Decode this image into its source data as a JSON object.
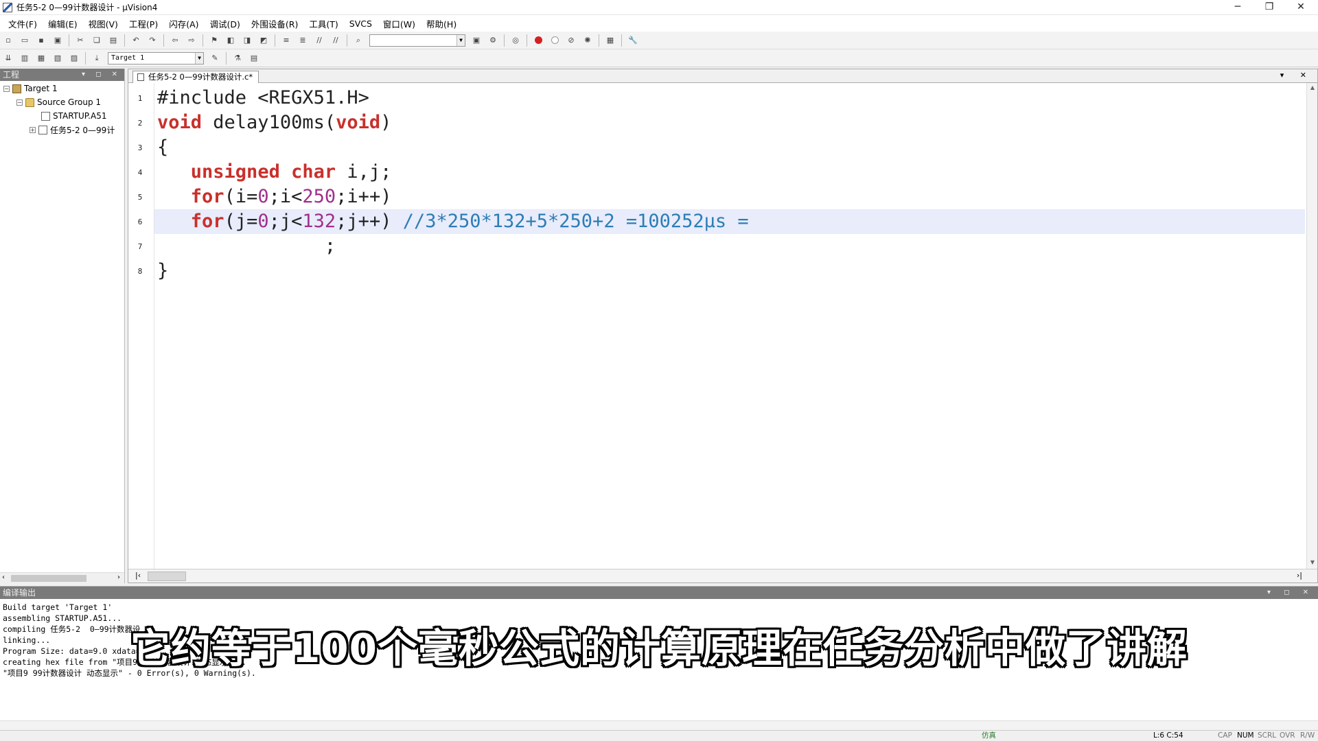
{
  "window": {
    "title": "任务5-2  0—99计数器设计 - µVision4",
    "minimize_glyph": "─",
    "restore_glyph": "❐",
    "close_glyph": "✕"
  },
  "menu": {
    "items": [
      "文件(F)",
      "编辑(E)",
      "视图(V)",
      "工程(P)",
      "闪存(A)",
      "调试(D)",
      "外围设备(R)",
      "工具(T)",
      "SVCS",
      "窗口(W)",
      "帮助(H)"
    ]
  },
  "toolbar2": {
    "target_value": "Target 1"
  },
  "project": {
    "header": "工程",
    "tree": {
      "target": "Target 1",
      "group": "Source Group 1",
      "file1": "STARTUP.A51",
      "file2": "任务5-2  0—99计"
    }
  },
  "editor": {
    "tab_label": "任务5-2  0—99计数器设计.c*",
    "line_numbers": [
      "1",
      "2",
      "3",
      "4",
      "5",
      "6",
      "7",
      "8"
    ],
    "current_line": 6,
    "code": {
      "l1": "#include <REGX51.H>",
      "l2_kw": "void",
      "l2_rest": " delay100ms(",
      "l2_kw2": "void",
      "l2_end": ")",
      "l3": "{",
      "l4_indent": "   ",
      "l4_kw1": "unsigned",
      "l4_sp": " ",
      "l4_kw2": "char",
      "l4_rest": " i,j;",
      "l5_indent": "   ",
      "l5_kw": "for",
      "l5_a": "(i=",
      "l5_n1": "0",
      "l5_b": ";i<",
      "l5_n2": "250",
      "l5_c": ";i++)",
      "l6_indent": "   ",
      "l6_kw": "for",
      "l6_a": "(j=",
      "l6_n1": "0",
      "l6_b": ";j<",
      "l6_n2": "132",
      "l6_c": ";j++) ",
      "l6_cmt": "//3*250*132+5*250+2 =100252µs =",
      "l7": "               ;",
      "l8": "}"
    }
  },
  "output": {
    "header": "编译输出",
    "lines": [
      "Build target 'Target 1'",
      "assembling STARTUP.A51...",
      "compiling 任务5-2  0—99计数器设",
      "linking...",
      "Program Size: data=9.0 xdata=0",
      "creating hex file from \"项目9 99计数器设计 动态显示\"...",
      "\"项目9 99计数器设计 动态显示\" - 0 Error(s), 0 Warning(s)."
    ]
  },
  "statusbar": {
    "mode": "仿真",
    "position": "L:6 C:54",
    "cap": "CAP",
    "num": "NUM",
    "scrl": "SCRL",
    "ovr": "OVR",
    "rw": "R/W"
  },
  "subtitle": "它约等于100个毫秒公式的计算原理在任务分析中做了讲解"
}
